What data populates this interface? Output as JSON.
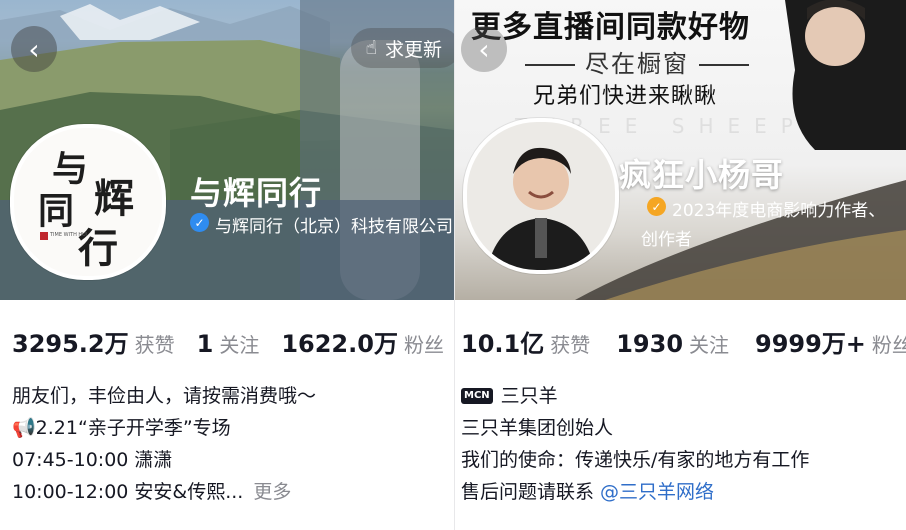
{
  "left": {
    "back_icon": "chevron-left-icon",
    "update_button": {
      "icon": "pointing-hand-icon",
      "label": "求更新"
    },
    "avatar": {
      "calligraphy_top": "与",
      "calligraphy_mid": "同",
      "calligraphy_right": "辉",
      "calligraphy_bottom": "行",
      "tagline": "TIME WITH HUI"
    },
    "nickname": "与辉同行",
    "verification": {
      "badge_color": "#2f8cf0",
      "text": "与辉同行（北京）科技有限公司"
    },
    "stats": [
      {
        "value": "3295.2万",
        "label": "获赞"
      },
      {
        "value": "1",
        "label": "关注"
      },
      {
        "value": "1622.0万",
        "label": "粉丝"
      }
    ],
    "bio": {
      "line1": "朋友们，丰俭由人，请按需消费哦～",
      "line2_icon": "megaphone-icon",
      "line2": "2.21“亲子开学季”专场",
      "line3": "07:45-10:00 潇潇",
      "line4": "10:00-12:00 安安&传熙...",
      "more": "更多"
    }
  },
  "right": {
    "back_icon": "chevron-left-icon",
    "promo": {
      "line1": "更多直播间同款好物",
      "line2": "尽在橱窗",
      "line3": "兄弟们快进来瞅瞅",
      "watermark": "THREE SHEEP"
    },
    "nickname": "疯狂小杨哥",
    "verification": {
      "badge_color": "#f5a623",
      "line1": "2023年度电商影响力作者、",
      "line2": "创作者"
    },
    "stats": [
      {
        "value": "10.1亿",
        "label": "获赞"
      },
      {
        "value": "1930",
        "label": "关注"
      },
      {
        "value": "9999万+",
        "label": "粉丝"
      }
    ],
    "bio": {
      "mcn_tag": "MCN",
      "mcn_name": "三只羊",
      "line1": "三只羊集团创始人",
      "line2": "我们的使命：传递快乐/有家的地方有工作",
      "line3_prefix": "售后问题请联系 ",
      "line3_link": "@三只羊网络"
    }
  }
}
